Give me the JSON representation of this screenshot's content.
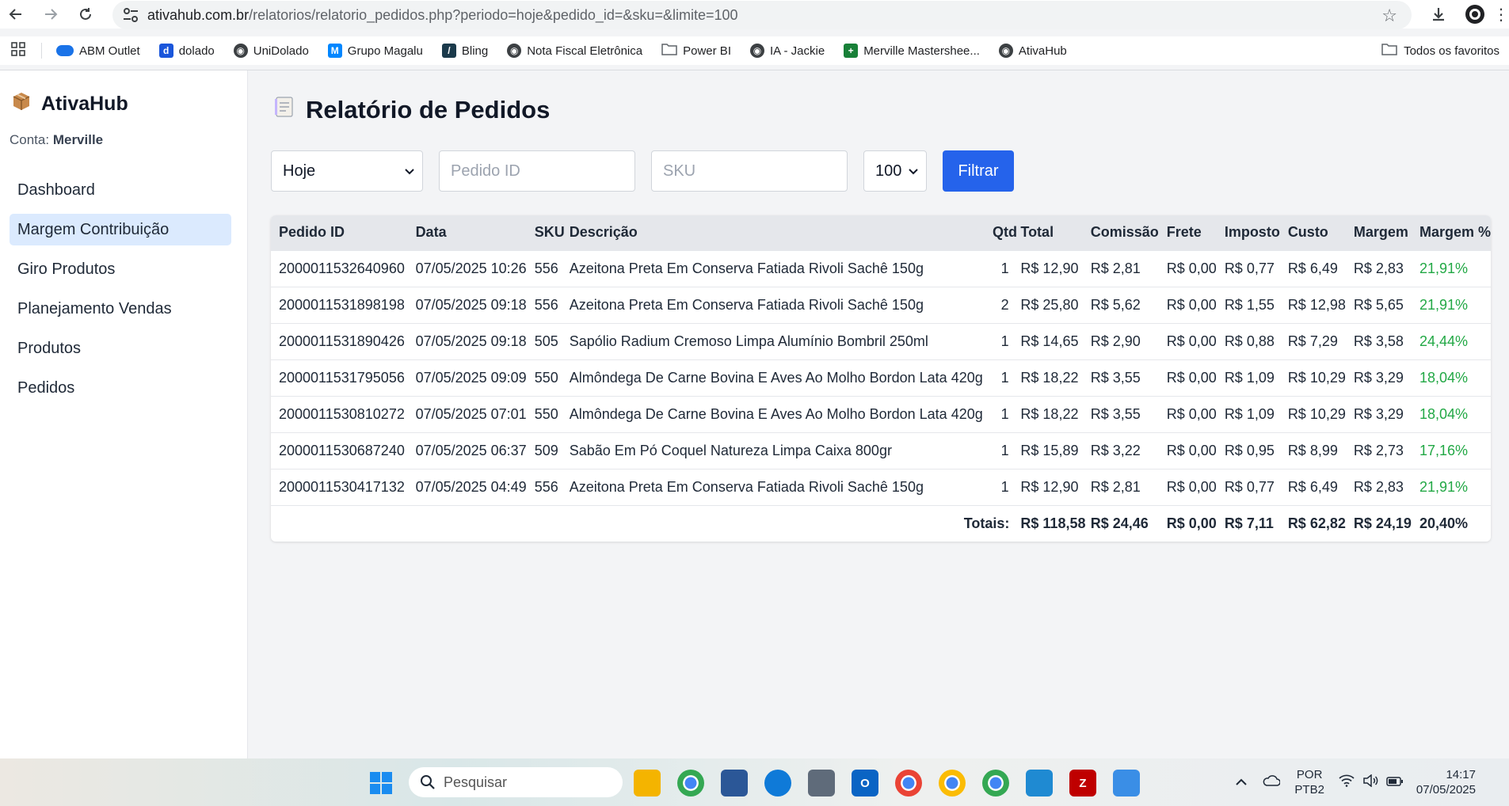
{
  "browser": {
    "url_host": "ativahub.com.br",
    "url_path": "/relatorios/relatorio_pedidos.php?periodo=hoje&pedido_id=&sku=&limite=100",
    "bookmarks": [
      {
        "label": "ABM Outlet",
        "icon": "cloud-icon",
        "color": "#1a73e8"
      },
      {
        "label": "dolado",
        "icon": "d-icon",
        "color": "#1a56db"
      },
      {
        "label": "UniDolado",
        "icon": "globe-icon",
        "color": "#3c4043"
      },
      {
        "label": "Grupo Magalu",
        "icon": "m-icon",
        "color": "#0086ff"
      },
      {
        "label": "Bling",
        "icon": "bling-icon",
        "color": "#1b3a4b"
      },
      {
        "label": "Nota Fiscal Eletrônica",
        "icon": "globe-icon",
        "color": "#3c4043"
      },
      {
        "label": "Power BI",
        "icon": "folder-icon",
        "color": "#5f6368"
      },
      {
        "label": "IA - Jackie",
        "icon": "globe-icon",
        "color": "#3c4043"
      },
      {
        "label": "Merville Mastershee...",
        "icon": "sheets-icon",
        "color": "#188038"
      },
      {
        "label": "AtivaHub",
        "icon": "globe-icon",
        "color": "#3c4043"
      }
    ],
    "all_bookmarks": "Todos os favoritos"
  },
  "sidebar": {
    "brand": "AtivaHub",
    "account_label": "Conta:",
    "account_name": "Merville",
    "items": [
      {
        "label": "Dashboard",
        "active": false
      },
      {
        "label": "Margem Contribuição",
        "active": true
      },
      {
        "label": "Giro Produtos",
        "active": false
      },
      {
        "label": "Planejamento Vendas",
        "active": false
      },
      {
        "label": "Produtos",
        "active": false
      },
      {
        "label": "Pedidos",
        "active": false
      }
    ]
  },
  "page": {
    "title": "Relatório de Pedidos"
  },
  "filters": {
    "periodo": "Hoje",
    "pedido_placeholder": "Pedido ID",
    "sku_placeholder": "SKU",
    "limite": "100",
    "button": "Filtrar"
  },
  "table": {
    "columns": [
      "Pedido ID",
      "Data",
      "SKU",
      "Descrição",
      "Qtd",
      "Total",
      "Comissão",
      "Frete",
      "Imposto",
      "Custo",
      "Margem",
      "Margem %"
    ],
    "rows": [
      [
        "2000011532640960",
        "07/05/2025 10:26",
        "556",
        "Azeitona Preta Em Conserva Fatiada Rivoli Sachê 150g",
        "1",
        "R$ 12,90",
        "R$ 2,81",
        "R$ 0,00",
        "R$ 0,77",
        "R$ 6,49",
        "R$ 2,83",
        "21,91%"
      ],
      [
        "2000011531898198",
        "07/05/2025 09:18",
        "556",
        "Azeitona Preta Em Conserva Fatiada Rivoli Sachê 150g",
        "2",
        "R$ 25,80",
        "R$ 5,62",
        "R$ 0,00",
        "R$ 1,55",
        "R$ 12,98",
        "R$ 5,65",
        "21,91%"
      ],
      [
        "2000011531890426",
        "07/05/2025 09:18",
        "505",
        "Sapólio Radium Cremoso Limpa Alumínio Bombril 250ml",
        "1",
        "R$ 14,65",
        "R$ 2,90",
        "R$ 0,00",
        "R$ 0,88",
        "R$ 7,29",
        "R$ 3,58",
        "24,44%"
      ],
      [
        "2000011531795056",
        "07/05/2025 09:09",
        "550",
        "Almôndega De Carne Bovina E Aves Ao Molho Bordon Lata 420g",
        "1",
        "R$ 18,22",
        "R$ 3,55",
        "R$ 0,00",
        "R$ 1,09",
        "R$ 10,29",
        "R$ 3,29",
        "18,04%"
      ],
      [
        "2000011530810272",
        "07/05/2025 07:01",
        "550",
        "Almôndega De Carne Bovina E Aves Ao Molho Bordon Lata 420g",
        "1",
        "R$ 18,22",
        "R$ 3,55",
        "R$ 0,00",
        "R$ 1,09",
        "R$ 10,29",
        "R$ 3,29",
        "18,04%"
      ],
      [
        "2000011530687240",
        "07/05/2025 06:37",
        "509",
        "Sabão Em Pó Coquel Natureza Limpa Caixa 800gr",
        "1",
        "R$ 15,89",
        "R$ 3,22",
        "R$ 0,00",
        "R$ 0,95",
        "R$ 8,99",
        "R$ 2,73",
        "17,16%"
      ],
      [
        "2000011530417132",
        "07/05/2025 04:49",
        "556",
        "Azeitona Preta Em Conserva Fatiada Rivoli Sachê 150g",
        "1",
        "R$ 12,90",
        "R$ 2,81",
        "R$ 0,00",
        "R$ 0,77",
        "R$ 6,49",
        "R$ 2,83",
        "21,91%"
      ]
    ],
    "totals": {
      "label": "Totais:",
      "total": "R$ 118,58",
      "comissao": "R$ 24,46",
      "frete": "R$ 0,00",
      "imposto": "R$ 7,11",
      "custo": "R$ 62,82",
      "margem": "R$ 24,19",
      "margem_pct": "20,40%"
    },
    "margin_color": "#22a845"
  },
  "taskbar": {
    "search_placeholder": "Pesquisar",
    "lang_top": "POR",
    "lang_bottom": "PTB2",
    "time": "14:17",
    "date": "07/05/2025"
  }
}
